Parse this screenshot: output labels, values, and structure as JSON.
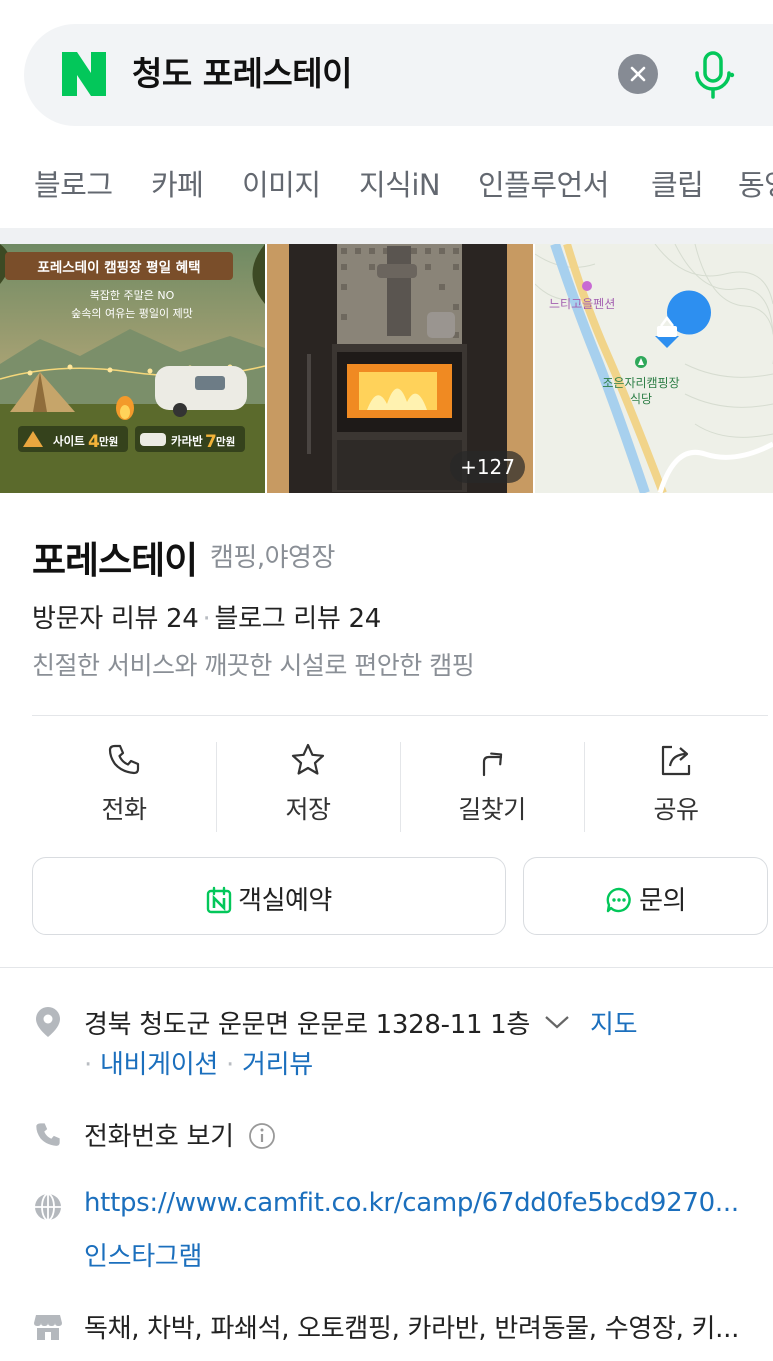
{
  "search": {
    "query": "청도 포레스테이",
    "clear_icon": "close-icon",
    "mic_icon": "mic-icon",
    "brand_color": "#03c75a"
  },
  "tabs": [
    "블로그",
    "카페",
    "이미지",
    "지식iN",
    "인플루언서",
    "클립",
    "동영"
  ],
  "photos": {
    "promo": {
      "title": "포레스테이 캠핑장 평일 혜택",
      "line1": "복잡한 주말은 NO",
      "line2": "숲속의 여유는 평일이 제맛",
      "site_price_prefix": "사이트",
      "site_price_num": "4",
      "site_price_unit": "만원",
      "caravan_price_prefix": "카라반",
      "caravan_price_num": "7",
      "caravan_price_unit": "만원"
    },
    "more_count": "+127",
    "map": {
      "label_pension": "느티고을펜션",
      "label_camp_line1": "조은자리캠핑장",
      "label_camp_line2": "식당"
    }
  },
  "place": {
    "name": "포레스테이",
    "category": "캠핑,야영장",
    "visitor_reviews": "방문자 리뷰 24",
    "blog_reviews": "블로그 리뷰 24",
    "description": "친절한 서비스와 깨끗한 시설로 편안한 캠핑"
  },
  "actions": [
    {
      "label": "전화",
      "icon": "phone-icon"
    },
    {
      "label": "저장",
      "icon": "star-icon"
    },
    {
      "label": "길찾기",
      "icon": "directions-icon"
    },
    {
      "label": "공유",
      "icon": "share-icon"
    }
  ],
  "buttons": {
    "reserve_label": "객실예약",
    "inquiry_label": "문의"
  },
  "details": {
    "address": "경북 청도군 운문면 운문로 1328-11 1층",
    "map_link": "지도",
    "navigation_link": "내비게이션",
    "streetview_link": "거리뷰",
    "phone_label": "전화번호 보기",
    "website": "https://www.camfit.co.kr/camp/67dd0fe5bcd9270...",
    "instagram": "인스타그램",
    "amenities": "독채, 차박, 파쇄석, 오토캠핑, 카라반, 반려동물, 수영장, 키..."
  },
  "colors": {
    "link": "#1b6fbd",
    "muted": "#8a8f96"
  }
}
